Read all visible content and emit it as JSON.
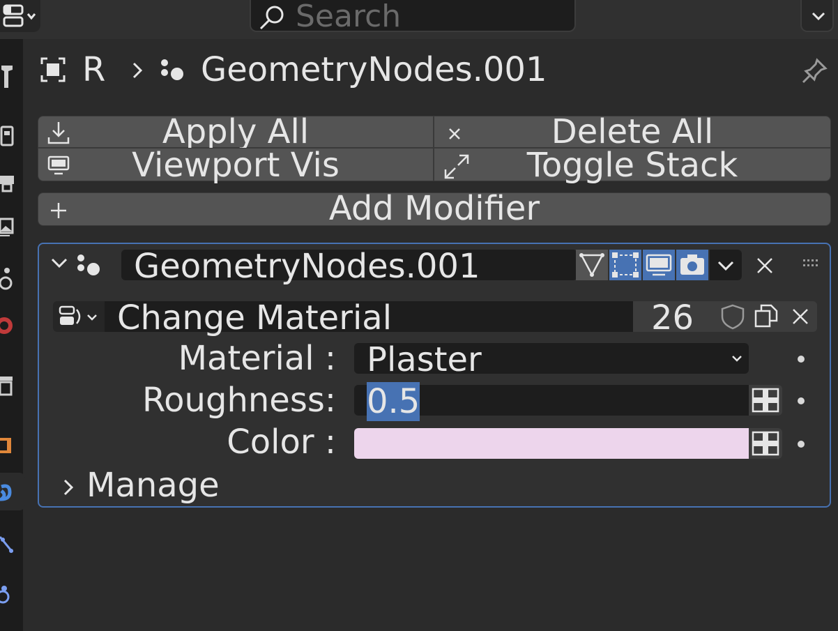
{
  "search": {
    "placeholder": "Search"
  },
  "header": {
    "object_name": "R",
    "modifier_name": "GeometryNodes.001"
  },
  "buttons": {
    "apply_all": "Apply All",
    "delete_all": "Delete All",
    "viewport_vis": "Viewport Vis",
    "toggle_stack": "Toggle Stack",
    "add_modifier": "Add Modifier"
  },
  "modifier": {
    "name": "GeometryNodes.001",
    "node_group": "Change Material",
    "user_count": "26",
    "inputs": [
      {
        "label": "Material :",
        "value": "Plaster"
      },
      {
        "label": "Roughness:",
        "value": "0.5"
      },
      {
        "label": "Color :",
        "value": "",
        "swatch": "#edd5ec"
      }
    ],
    "manage_label": "Manage"
  },
  "colors": {
    "accent": "#4772b3",
    "selection": "#4772b3",
    "background": "#2b2b2b"
  }
}
